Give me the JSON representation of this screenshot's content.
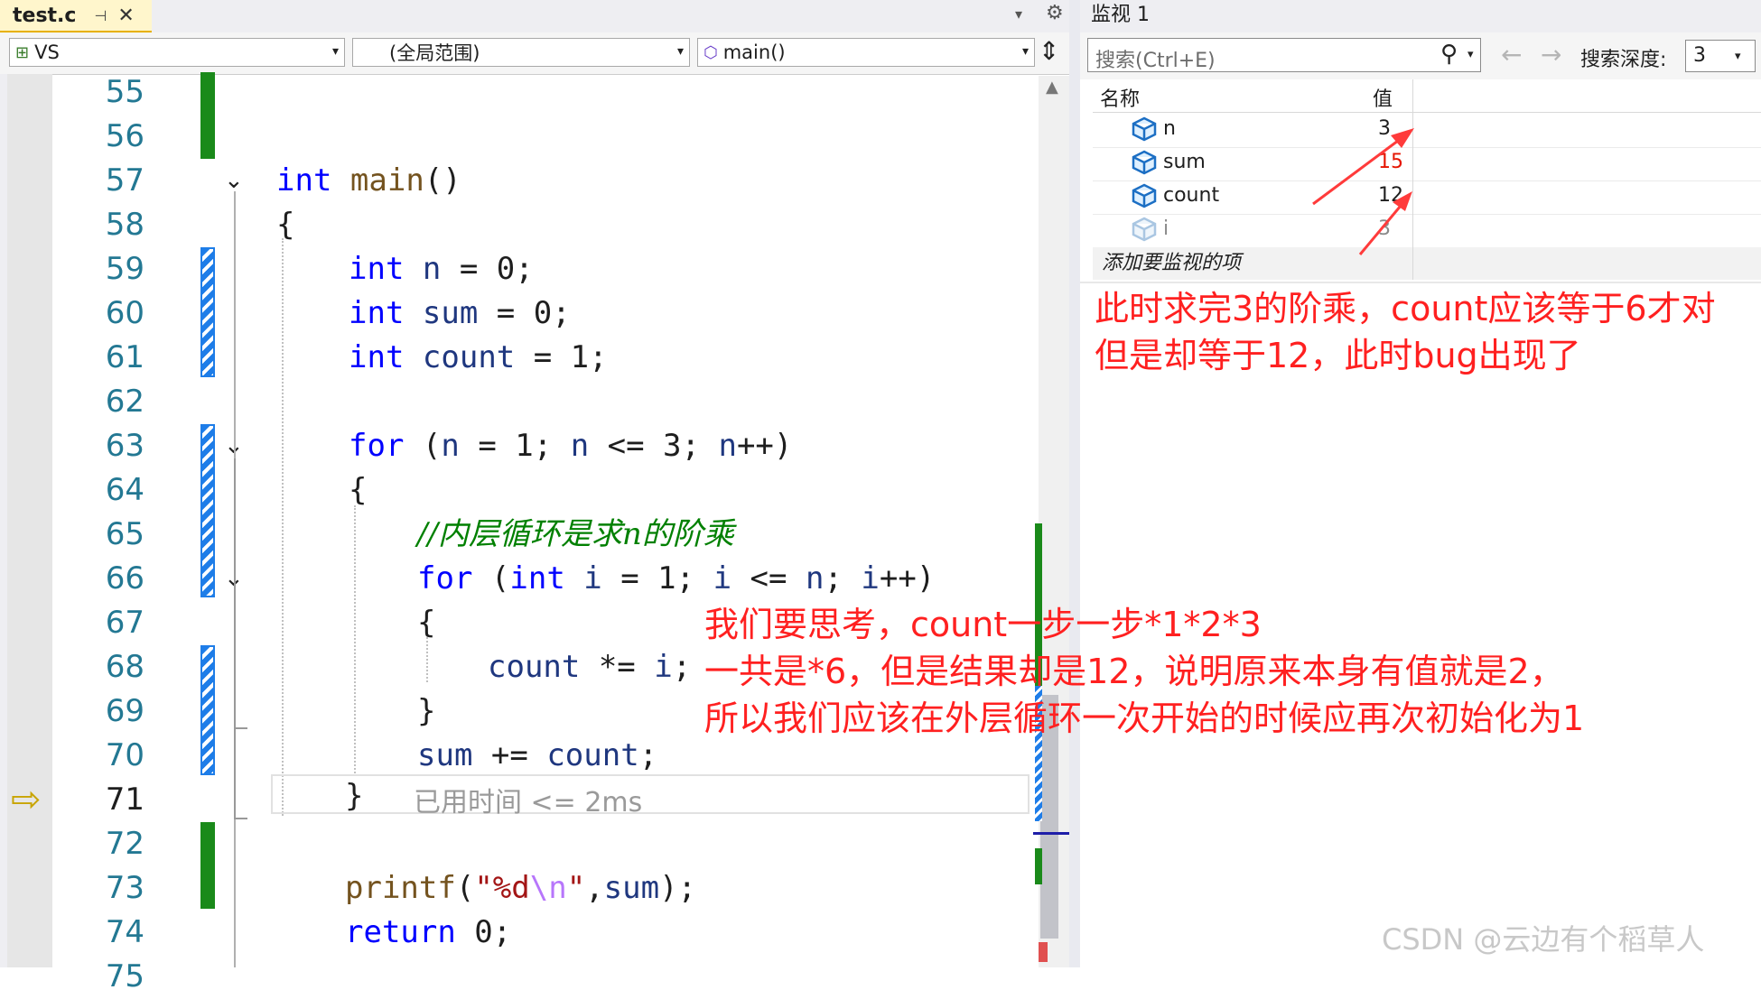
{
  "editor": {
    "tab_title": "test.c",
    "tab_pin": "⊣",
    "tab_close": "✕",
    "tab_dropdown": "▾",
    "gear": "⚙",
    "nav_project": "VS",
    "nav_scope": "(全局范围)",
    "nav_function": "main()",
    "split_icon": "⇕",
    "lines": [
      "55",
      "56",
      "57",
      "58",
      "59",
      "60",
      "61",
      "62",
      "63",
      "64",
      "65",
      "66",
      "67",
      "68",
      "69",
      "70",
      "71",
      "72",
      "73",
      "74",
      "75"
    ],
    "current_line": "71",
    "elapsed": "已用时间 <= 2ms",
    "code": {
      "l57": {
        "kw": "int",
        "fn": "main",
        "rest": "()"
      },
      "l58": "{",
      "l59": {
        "kw": "int",
        "var": "n",
        "rest": " = 0;"
      },
      "l60": {
        "kw": "int",
        "var": "sum",
        "rest": " = 0;"
      },
      "l61": {
        "kw": "int",
        "var": "count",
        "rest": " = 1;"
      },
      "l63": {
        "kw": "for",
        "open": " (",
        "v1": "n",
        "a": " = 1; ",
        "v2": "n",
        "b": " <= 3; ",
        "v3": "n",
        "c": "++)"
      },
      "l64": "{",
      "l65": "//内层循环是求n的阶乘",
      "l66": {
        "kw": "for",
        "open": " (",
        "kw2": "int",
        "v1": "i",
        "a": " = 1; ",
        "v2": "i",
        "b": " <= ",
        "v3": "n",
        "c": "; ",
        "v4": "i",
        "d": "++)"
      },
      "l67": "{",
      "l68": {
        "var": "count",
        "op": " *= ",
        "v2": "i",
        "rest": ";"
      },
      "l69": "}",
      "l70": {
        "var": "sum",
        "op": " += ",
        "v2": "count",
        "rest": ";"
      },
      "l71": "}",
      "l73": {
        "fn": "printf",
        "open": "(",
        "str1": "\"%d",
        "esc": "\\n",
        "str2": "\"",
        "comma": ",",
        "var": "sum",
        "rest": ");"
      },
      "l74": {
        "kw": "return",
        "rest": " 0;"
      }
    }
  },
  "watch": {
    "title": "监视 1",
    "search_placeholder": "搜索(Ctrl+E)",
    "search_icon": "⚲",
    "dropdown": "▾",
    "back": "←",
    "forward": "→",
    "depth_label": "搜索深度:",
    "depth_value": "3",
    "col_name": "名称",
    "col_value": "值",
    "rows": [
      {
        "name": "n",
        "value": "3",
        "changed": false,
        "stale": false
      },
      {
        "name": "sum",
        "value": "15",
        "changed": true,
        "stale": false
      },
      {
        "name": "count",
        "value": "12",
        "changed": false,
        "stale": false
      },
      {
        "name": "i",
        "value": "3",
        "changed": false,
        "stale": true
      }
    ],
    "add_item": "添加要监视的项"
  },
  "annotations": {
    "note1_line1": "此时求完3的阶乘，count应该等于6才对",
    "note1_line2": "但是却等于12，此时bug出现了",
    "note2_line1": "我们要思考，count一步一步*1*2*3",
    "note2_line2": "一共是*6，但是结果却是12，说明原来本身有值就是2，",
    "note2_line3": "所以我们应该在外层循环一次开始的时候应再次初始化为1",
    "color": "#ff2020"
  },
  "watermark": "CSDN @云边有个稻草人",
  "colors": {
    "keyword": "#0000ff",
    "function": "#74531f",
    "variable": "#1f377f",
    "comment": "#008000",
    "string": "#a31515",
    "line_number": "#237893",
    "changed_value": "#e51400"
  }
}
